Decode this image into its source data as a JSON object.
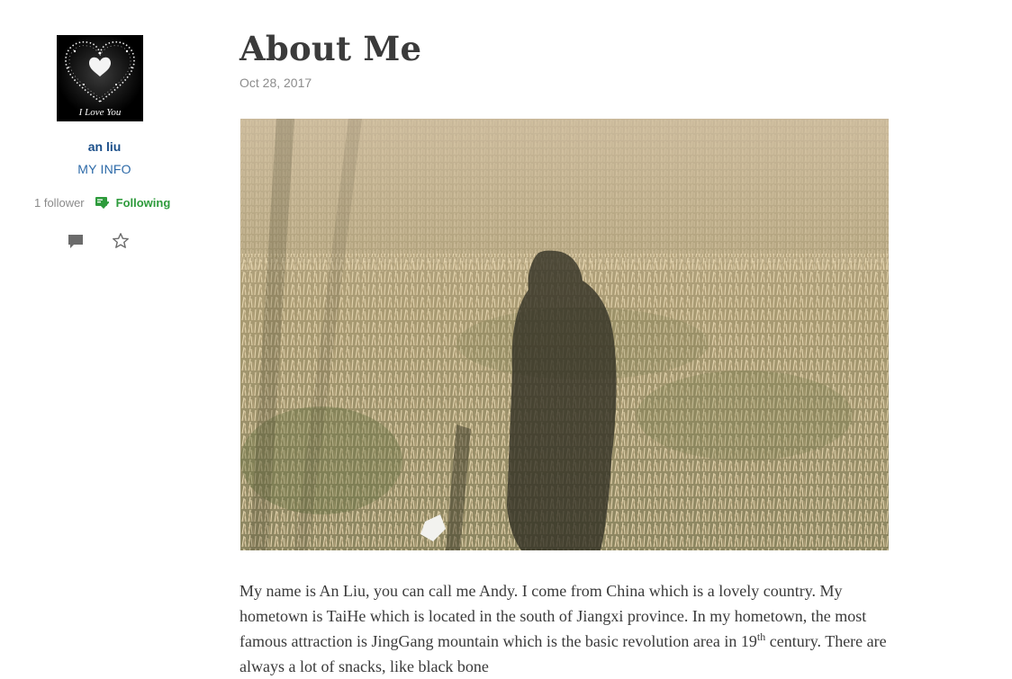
{
  "author": {
    "avatar_caption": "I Love You",
    "name": "an liu",
    "info_link": "MY INFO",
    "follower_count": "1 follower",
    "following_label": "Following"
  },
  "post": {
    "title": "About Me",
    "date": "Oct 28, 2017",
    "body": {
      "part1": "My name is An Liu, you can call me Andy. I come from China which is a lovely country. My hometown is TaiHe which is located in the south of Jiangxi province. In my hometown, the most famous attraction is JingGang mountain which is the basic revolution area in 19",
      "sup": "th",
      "part2": " century. There are always a lot of snacks, like black bone"
    }
  },
  "icons": {
    "avatar": "heart-avatar-image",
    "following": "following-check-icon",
    "comment": "comment-icon",
    "star": "star-icon"
  },
  "colors": {
    "author_name": "#1b4f8a",
    "info_link": "#2d6aa8",
    "following": "#2e9b3c",
    "muted": "#8a8a8a",
    "title": "#3b3b3b"
  }
}
